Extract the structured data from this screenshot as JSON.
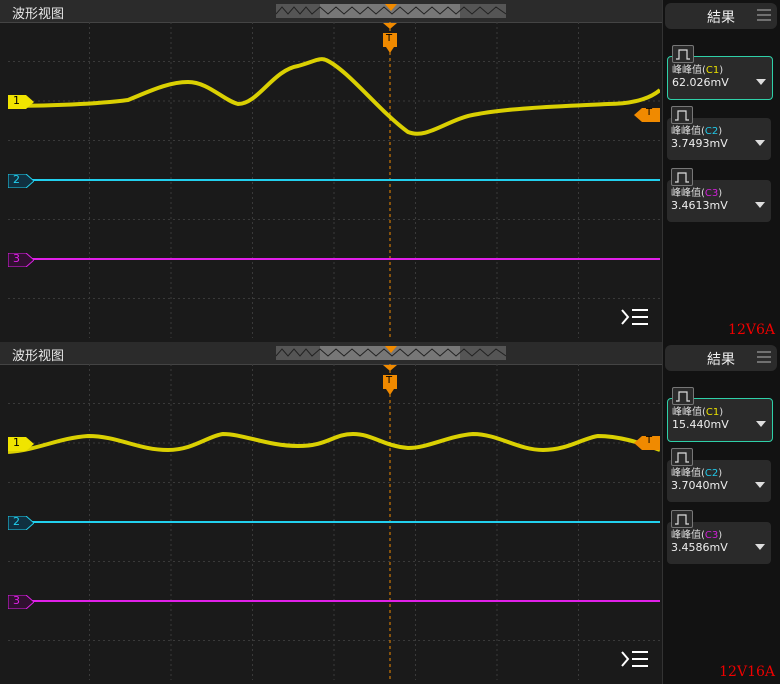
{
  "panels": [
    {
      "view_title": "波形视图",
      "results_title": "結果",
      "channel_labels": [
        "1",
        "2",
        "3"
      ],
      "trigger_label": "T",
      "measurements": [
        {
          "name": "峰峰值",
          "channel": "C1",
          "value": "62.026mV",
          "color": "#e8e000"
        },
        {
          "name": "峰峰值",
          "channel": "C2",
          "value": "3.7493mV",
          "color": "#22c8e8"
        },
        {
          "name": "峰峰值",
          "channel": "C3",
          "value": "3.4613mV",
          "color": "#d020d8"
        }
      ],
      "annotation": "12V6A"
    },
    {
      "view_title": "波形视图",
      "results_title": "結果",
      "channel_labels": [
        "1",
        "2",
        "3"
      ],
      "trigger_label": "T",
      "measurements": [
        {
          "name": "峰峰值",
          "channel": "C1",
          "value": "15.440mV",
          "color": "#e8e000"
        },
        {
          "name": "峰峰值",
          "channel": "C2",
          "value": "3.7040mV",
          "color": "#22c8e8"
        },
        {
          "name": "峰峰值",
          "channel": "C3",
          "value": "3.4586mV",
          "color": "#d020d8"
        }
      ],
      "annotation": "12V16A"
    }
  ],
  "colors": {
    "ch1": "#f0e400",
    "ch2": "#22d0ee",
    "ch3": "#e020e8",
    "trigger": "#f08a00",
    "accent": "#2fd0a8"
  },
  "icons": {
    "measure": "pulse-icon",
    "menu": "menu-icon",
    "trace-list": "trace-list-icon"
  }
}
